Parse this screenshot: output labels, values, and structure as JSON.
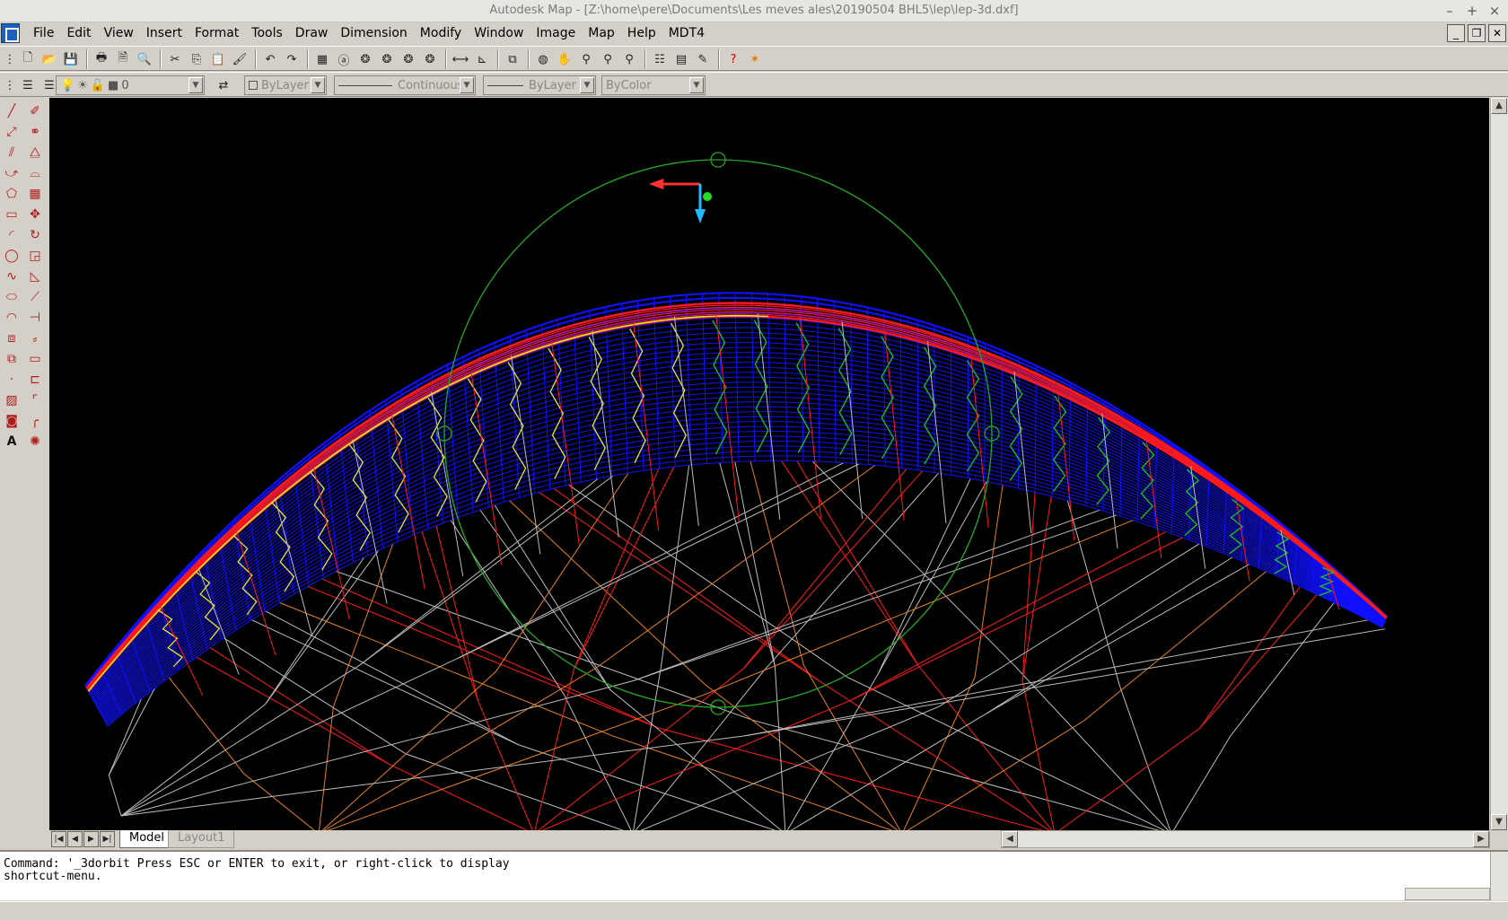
{
  "window": {
    "title": "Autodesk Map - [Z:\\home\\pere\\Documents\\Les meves ales\\20190504 BHL5\\lep\\lep-3d.dxf]",
    "controls": [
      "–",
      "+",
      "×"
    ]
  },
  "menubar": {
    "items": [
      "File",
      "Edit",
      "View",
      "Insert",
      "Format",
      "Tools",
      "Draw",
      "Dimension",
      "Modify",
      "Window",
      "Image",
      "Map",
      "Help",
      "MDT4"
    ]
  },
  "properties": {
    "layer": "0",
    "color": "ByLayer",
    "linetype": "Continuous",
    "lineweight": "ByLayer",
    "plotstyle": "ByColor"
  },
  "tabs": {
    "model": "Model",
    "layout": "Layout1"
  },
  "command": {
    "line1": "Command: '_3dorbit Press ESC or ENTER to exit, or right-click to display",
    "line2": "shortcut-menu."
  },
  "colors": {
    "canvas_bg": "#000000",
    "blue_mesh": "#1010ff",
    "red_lines": "#ff1a1a",
    "green_lines": "#19c619",
    "yellow_lines": "#e8e832",
    "orange_lines": "#e8801e",
    "grey_lines": "#bdbdbd",
    "orbit_circle": "#22aa22"
  }
}
